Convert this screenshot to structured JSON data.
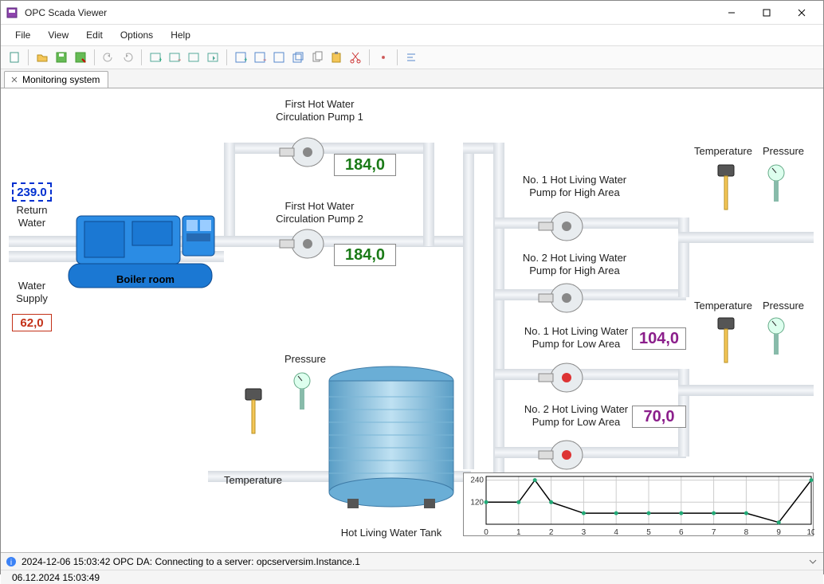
{
  "window": {
    "title": "OPC Scada Viewer"
  },
  "menu": {
    "file": "File",
    "view": "View",
    "edit": "Edit",
    "options": "Options",
    "help": "Help"
  },
  "tab": {
    "label": "Monitoring system"
  },
  "labels": {
    "pump1": "First Hot Water\nCirculation Pump 1",
    "pump2": "First Hot Water\nCirculation Pump 2",
    "return_water": "Return\nWater",
    "water_supply": "Water\nSupply",
    "boiler": "Boiler room",
    "pressure": "Pressure",
    "temperature": "Temperature",
    "tank": "Hot Living Water Tank",
    "hi1": "No. 1 Hot Living Water\nPump for High Area",
    "hi2": "No. 2 Hot Living Water\nPump for High Area",
    "lo1": "No. 1 Hot Living Water\nPump for Low Area",
    "lo2": "No. 2 Hot Living Water\nPump for Low Area",
    "temp_top": "Temperature",
    "press_top": "Pressure",
    "temp_bot": "Temperature",
    "press_bot": "Pressure"
  },
  "values": {
    "return_water": "239.0",
    "water_supply": "62,0",
    "pump1": "184,0",
    "pump2": "184,0",
    "lo1": "104,0",
    "lo2": "70,0"
  },
  "chart_data": {
    "type": "line",
    "x": [
      0,
      1,
      1.5,
      2,
      3,
      4,
      5,
      6,
      7,
      8,
      9,
      10
    ],
    "values": [
      120,
      120,
      240,
      120,
      60,
      60,
      60,
      60,
      60,
      60,
      10,
      240
    ],
    "xlim": [
      0,
      10
    ],
    "ylim": [
      0,
      260
    ],
    "yticks": [
      120,
      240
    ],
    "xticks": [
      0,
      1,
      2,
      3,
      4,
      5,
      6,
      7,
      8,
      9,
      10
    ]
  },
  "status": {
    "message": "2024-12-06 15:03:42 OPC DA: Connecting to a server: opcserversim.Instance.1"
  },
  "time": "06.12.2024 15:03:49"
}
